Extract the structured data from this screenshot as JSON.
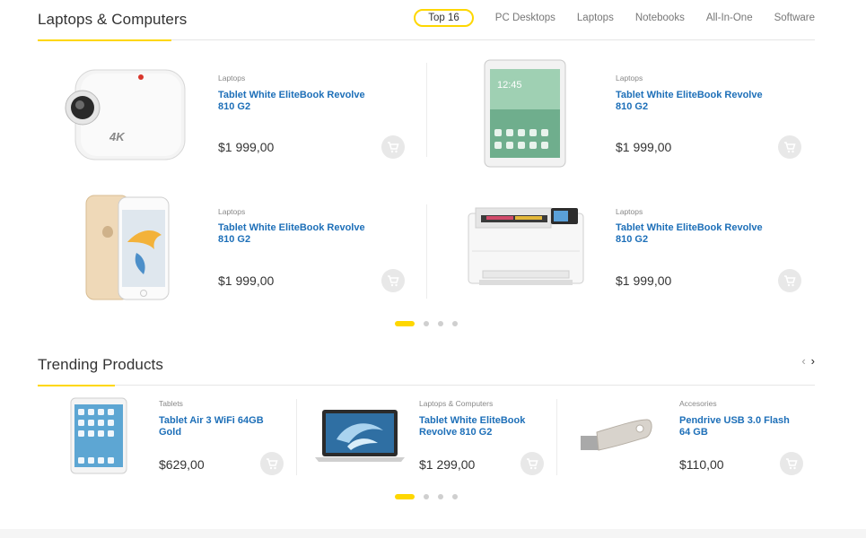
{
  "top": {
    "title": "Laptops & Computers",
    "tabs": [
      "Top 16",
      "PC Desktops",
      "Laptops",
      "Notebooks",
      "All-In-One",
      "Software"
    ],
    "products": [
      {
        "category": "Laptops",
        "name": "Tablet White EliteBook Revolve 810 G2",
        "price": "$1 999,00",
        "image": "action-camera"
      },
      {
        "category": "Laptops",
        "name": "Tablet White EliteBook Revolve 810 G2",
        "price": "$1 999,00",
        "image": "tablet"
      },
      {
        "category": "Laptops",
        "name": "Tablet White EliteBook Revolve 810 G2",
        "price": "$1 999,00",
        "image": "smartphone"
      },
      {
        "category": "Laptops",
        "name": "Tablet White EliteBook Revolve 810 G2",
        "price": "$1 999,00",
        "image": "printer"
      }
    ],
    "pager": {
      "pages": 4,
      "active": 1
    }
  },
  "trending": {
    "title": "Trending Products",
    "products": [
      {
        "category": "Tablets",
        "name": "Tablet Air 3 WiFi 64GB Gold",
        "price": "$629,00",
        "image": "ipad"
      },
      {
        "category": "Laptops & Computers",
        "name": "Tablet White EliteBook Revolve 810 G2",
        "price": "$1 299,00",
        "image": "laptop"
      },
      {
        "category": "Accesories",
        "name": "Pendrive USB 3.0 Flash 64 GB",
        "price": "$110,00",
        "image": "usb-drive"
      }
    ],
    "pager": {
      "pages": 4,
      "active": 1
    }
  },
  "icons": {
    "cart": "cart-icon",
    "prev": "chevron-left-icon",
    "next": "chevron-right-icon"
  },
  "colors": {
    "accent": "#fed700",
    "link": "#1d6fb8",
    "text": "#333333"
  }
}
